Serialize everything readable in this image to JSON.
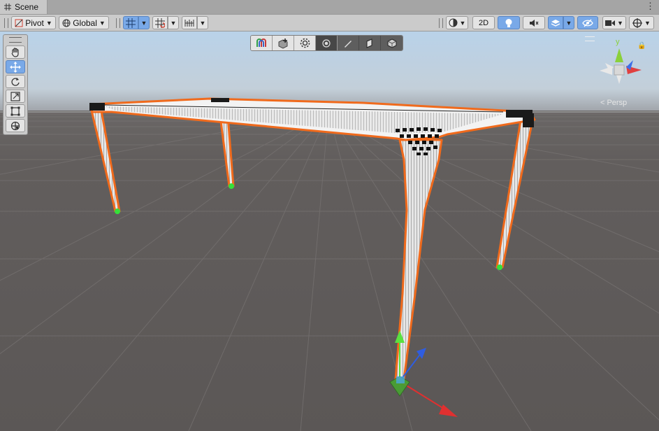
{
  "window": {
    "tab_label": "Scene",
    "tab_icon": "grid-icon",
    "menu_icon": "kebab-menu-icon"
  },
  "toolbar": {
    "pivot_label": "Pivot",
    "global_label": "Global",
    "mode_2d_label": "2D",
    "icons": [
      "pivot-icon",
      "global-icon",
      "grid-snap-icon",
      "increment-snap-icon",
      "ruler-icon",
      "shading-icon",
      "lighting-icon",
      "audio-icon",
      "effects-icon",
      "visibility-icon",
      "camera-icon",
      "gizmos-icon"
    ]
  },
  "tools": {
    "items": [
      "view-tool",
      "move-tool",
      "rotate-tool",
      "scale-tool",
      "rect-tool",
      "transform-tool"
    ],
    "active": "move-tool"
  },
  "overlays": {
    "items": [
      "component-tools-icon",
      "create-object-icon",
      "settings-icon",
      "center-icon",
      "draw-icon",
      "face-icon",
      "object-icon"
    ]
  },
  "gizmo": {
    "y_label": "y",
    "projection_label": "Persp",
    "colors": {
      "x": "#e04040",
      "y": "#8ad03a",
      "z": "#3d6ee8"
    }
  },
  "scene": {
    "background": "#5f5b5a",
    "sky_top": "#bcd4ea",
    "horizon": "#9b9ea3",
    "selection_outline": "#f06a1c",
    "object": "table"
  }
}
